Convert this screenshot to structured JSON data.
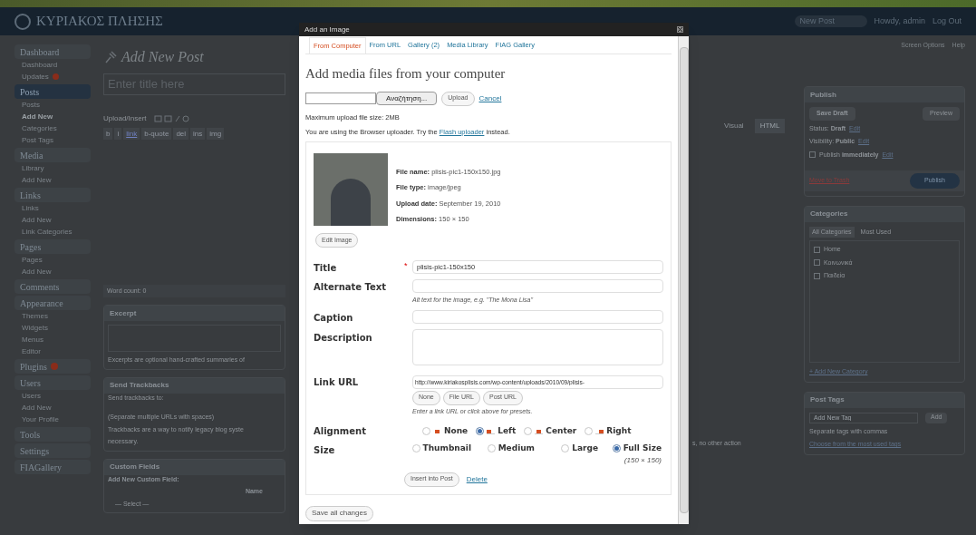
{
  "header": {
    "site_title": "ΚΥΡΙΑΚΟΣ ΠΛΗΣΗΣ",
    "favorite_action": "New Post",
    "greeting": "Howdy, admin",
    "logout": "Log Out",
    "screen_options": "Screen Options",
    "help": "Help"
  },
  "sidebar": {
    "menus": [
      {
        "label": "Dashboard",
        "selected": false,
        "badge": false,
        "items": [
          {
            "label": "Dashboard",
            "selected": false,
            "badge": false
          },
          {
            "label": "Updates",
            "selected": false,
            "badge": true
          }
        ]
      },
      {
        "label": "Posts",
        "selected": true,
        "badge": false,
        "items": [
          {
            "label": "Posts",
            "selected": false,
            "badge": false
          },
          {
            "label": "Add New",
            "selected": true,
            "badge": false
          },
          {
            "label": "Categories",
            "selected": false,
            "badge": false
          },
          {
            "label": "Post Tags",
            "selected": false,
            "badge": false
          }
        ]
      },
      {
        "label": "Media",
        "selected": false,
        "badge": false,
        "items": [
          {
            "label": "Library",
            "selected": false,
            "badge": false
          },
          {
            "label": "Add New",
            "selected": false,
            "badge": false
          }
        ]
      },
      {
        "label": "Links",
        "selected": false,
        "badge": false,
        "items": [
          {
            "label": "Links",
            "selected": false,
            "badge": false
          },
          {
            "label": "Add New",
            "selected": false,
            "badge": false
          },
          {
            "label": "Link Categories",
            "selected": false,
            "badge": false
          }
        ]
      },
      {
        "label": "Pages",
        "selected": false,
        "badge": false,
        "items": [
          {
            "label": "Pages",
            "selected": false,
            "badge": false
          },
          {
            "label": "Add New",
            "selected": false,
            "badge": false
          }
        ]
      },
      {
        "label": "Comments",
        "selected": false,
        "badge": false
      },
      {
        "label": "Appearance",
        "selected": false,
        "badge": false,
        "items": [
          {
            "label": "Themes",
            "selected": false,
            "badge": false
          },
          {
            "label": "Widgets",
            "selected": false,
            "badge": false
          },
          {
            "label": "Menus",
            "selected": false,
            "badge": false
          },
          {
            "label": "Editor",
            "selected": false,
            "badge": false
          }
        ]
      },
      {
        "label": "Plugins",
        "selected": false,
        "badge": true
      },
      {
        "label": "Users",
        "selected": false,
        "badge": false,
        "items": [
          {
            "label": "Users",
            "selected": false,
            "badge": false
          },
          {
            "label": "Add New",
            "selected": false,
            "badge": false
          },
          {
            "label": "Your Profile",
            "selected": false,
            "badge": false
          }
        ]
      },
      {
        "label": "Tools",
        "selected": false,
        "badge": false
      },
      {
        "label": "Settings",
        "selected": false,
        "badge": false
      },
      {
        "label": "FIAGallery",
        "selected": false,
        "badge": false
      }
    ]
  },
  "editor": {
    "heading": "Add New Post",
    "title_placeholder": "Enter title here",
    "upload_insert": "Upload/Insert",
    "modes": [
      {
        "label": "Visual",
        "selected": false
      },
      {
        "label": "HTML",
        "selected": true
      }
    ],
    "quicktags": [
      "b",
      "i",
      "link",
      "b-quote",
      "del",
      "ins",
      "img"
    ],
    "word_count": "Word count: 0"
  },
  "excerpt": {
    "title": "Excerpt",
    "help": "Excerpts are optional hand-crafted summaries of"
  },
  "trackbacks": {
    "title": "Send Trackbacks",
    "label": "Send trackbacks to:",
    "hint": "(Separate multiple URLs with spaces)",
    "help_start": "Trackbacks are a way to notify legacy blog syste",
    "help_end": "s, no other action",
    "help_line2": "necessary."
  },
  "custom_fields": {
    "title": "Custom Fields",
    "subtitle": "Add New Custom Field:",
    "column": "Name",
    "select": "— Select —"
  },
  "publish": {
    "title": "Publish",
    "save_draft": "Save Draft",
    "preview": "Preview",
    "settings": [
      {
        "text": "Status: **Draft**",
        "edit": "Edit",
        "kind": "status"
      },
      {
        "text": "Visibility: **Public**",
        "edit": "Edit",
        "kind": "visibility"
      },
      {
        "text": "Publish **immediately**",
        "edit": "Edit",
        "kind": "schedule"
      }
    ],
    "trash": "Move to Trash",
    "publish_button": "Publish"
  },
  "categories": {
    "title": "Categories",
    "tabs": [
      {
        "label": "All Categories",
        "selected": true
      },
      {
        "label": "Most Used",
        "selected": false
      }
    ],
    "items": [
      {
        "label": "Home",
        "checked": false
      },
      {
        "label": "Κοινωνικά",
        "checked": false
      },
      {
        "label": "Παιδεία",
        "checked": false
      }
    ],
    "add_new": "+ Add New Category"
  },
  "tags": {
    "title": "Post Tags",
    "placeholder": "Add New Tag",
    "add": "Add",
    "hint": "Separate tags with commas",
    "choose": "Choose from the most used tags"
  },
  "dialog": {
    "title": "Add an Image",
    "tabs": [
      {
        "label": "From Computer",
        "selected": true
      },
      {
        "label": "From URL",
        "selected": false
      },
      {
        "label": "Gallery (2)",
        "selected": false
      },
      {
        "label": "Media Library",
        "selected": false
      },
      {
        "label": "FIAG Gallery",
        "selected": false
      }
    ],
    "heading": "Add media files from your computer",
    "browse": "Αναζήτηση...",
    "upload": "Upload",
    "cancel": "Cancel",
    "max_size": "Maximum upload file size: 2MB",
    "uploader_note": {
      "before": "You are using the Browser uploader. Try the",
      "link": "Flash uploader",
      "after": "instead."
    },
    "file_info": [
      {
        "label": "File name:",
        "value": "plisis-pic1-150x150.jpg"
      },
      {
        "label": "File type:",
        "value": "image/jpeg"
      },
      {
        "label": "Upload date:",
        "value": "September 19, 2010"
      },
      {
        "label": "Dimensions:",
        "value": "150 × 150"
      }
    ],
    "edit_image": "Edit Image",
    "required_mark": "*",
    "fields": [
      {
        "kind": "text",
        "label": "Title",
        "required": true,
        "value": "plisis-pic1-150x150"
      },
      {
        "kind": "text",
        "label": "Alternate Text",
        "required": false,
        "help": "Alt text for the image, e.g. \"The Mona Lisa\""
      },
      {
        "kind": "text",
        "label": "Caption",
        "required": false
      },
      {
        "kind": "textarea",
        "label": "Description",
        "required": false
      }
    ],
    "link_url": {
      "label": "Link URL",
      "value": "http://www.kiriakosplisis.com/wp-content/uploads/2010/09/plisis-",
      "presets": [
        "None",
        "File URL",
        "Post URL"
      ],
      "help": "Enter a link URL or click above for presets."
    },
    "alignment": {
      "label": "Alignment",
      "options": [
        {
          "label": "None",
          "selected": false
        },
        {
          "label": "Left",
          "selected": true
        },
        {
          "label": "Center",
          "selected": false
        },
        {
          "label": "Right",
          "selected": false
        }
      ]
    },
    "size": {
      "label": "Size",
      "options": [
        {
          "label": "Thumbnail",
          "selected": false
        },
        {
          "label": "Medium",
          "selected": false
        },
        {
          "label": "Large",
          "selected": false
        },
        {
          "label": "Full Size",
          "selected": true,
          "note": "(150 × 150)"
        }
      ]
    },
    "insert": "Insert into Post",
    "delete": "Delete",
    "save_all": "Save all changes"
  }
}
